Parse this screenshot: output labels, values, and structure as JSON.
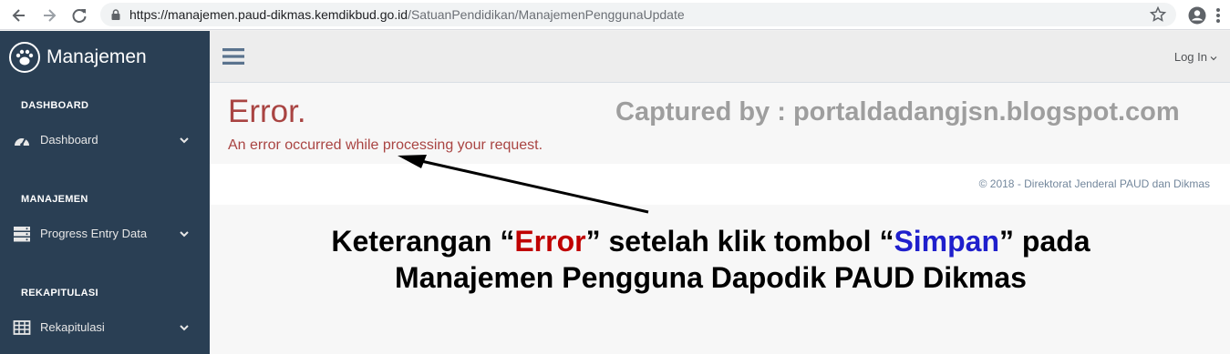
{
  "browser": {
    "url_host": "https://manajemen.paud-dikmas.kemdikbud.go.id",
    "url_path": "/SatuanPendidikan/ManajemenPenggunaUpdate",
    "icons": [
      "back-icon",
      "forward-icon",
      "reload-icon",
      "lock-icon",
      "star-icon",
      "account-icon",
      "more-icon"
    ]
  },
  "sidebar": {
    "brand": "Manajemen",
    "sections": [
      {
        "title": "DASHBOARD",
        "item": {
          "label": "Dashboard",
          "icon": "tachometer-icon"
        }
      },
      {
        "title": "MANAJEMEN",
        "item": {
          "label": "Progress Entry Data",
          "icon": "server-icon"
        }
      },
      {
        "title": "REKAPITULASI",
        "item": {
          "label": "Rekapitulasi",
          "icon": "table-icon"
        }
      }
    ]
  },
  "topnav": {
    "login_label": "Log In"
  },
  "main": {
    "error_title": "Error.",
    "error_message": "An error occurred while processing your request.",
    "watermark": "Captured by : portaldadangjsn.blogspot.com",
    "footer": "©  2018 - Direktorat Jenderal PAUD dan Dikmas"
  },
  "annotation": {
    "l1_a": "Keterangan “",
    "l1_red": "Error",
    "l1_b": "” setelah klik tombol “",
    "l1_blue": "Simpan",
    "l1_c": "” pada",
    "l2": "Manajemen Pengguna Dapodik PAUD Dikmas"
  },
  "colors": {
    "sidebar_bg": "#2a3f54",
    "error_red": "#a94442",
    "annotation_red": "#c00000",
    "annotation_blue": "#1f1fcc"
  }
}
